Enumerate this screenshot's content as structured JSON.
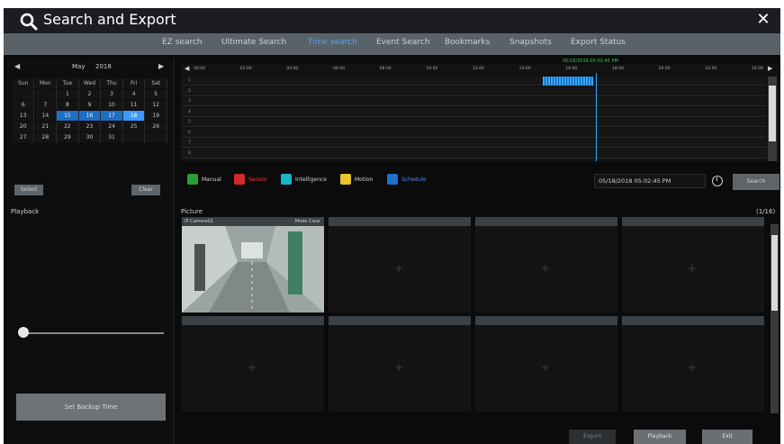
{
  "window": {
    "title": "Search and Export"
  },
  "tabs": [
    {
      "label": "EZ search",
      "active": false
    },
    {
      "label": "Ultimate Search",
      "active": false
    },
    {
      "label": "Time search",
      "active": true
    },
    {
      "label": "Event Search",
      "active": false
    },
    {
      "label": "Bookmarks",
      "active": false
    },
    {
      "label": "Snapshots",
      "active": false
    },
    {
      "label": "Export Status",
      "active": false
    }
  ],
  "calendar": {
    "month": "May",
    "year": "2018",
    "weekdays": [
      "Sun",
      "Mon",
      "Tue",
      "Wed",
      "Thu",
      "Fri",
      "Sat"
    ],
    "weeks": [
      [
        "",
        "",
        "1",
        "2",
        "3",
        "4",
        "5"
      ],
      [
        "6",
        "7",
        "8",
        "9",
        "10",
        "11",
        "12"
      ],
      [
        "13",
        "14",
        "15",
        "16",
        "17",
        "18",
        "19"
      ],
      [
        "20",
        "21",
        "22",
        "23",
        "24",
        "25",
        "26"
      ],
      [
        "27",
        "28",
        "29",
        "30",
        "31",
        "",
        ""
      ]
    ],
    "highlighted": [
      "15",
      "16",
      "17"
    ],
    "selected": "18",
    "select_label": "Select",
    "clear_label": "Clear"
  },
  "playback": {
    "label": "Playback",
    "progress": 0,
    "set_backup_label": "Set Backup Time"
  },
  "timeline": {
    "marker_label": "05/18/2018 05:02:45 PM",
    "ticks": [
      "00:00",
      "02:00",
      "04:00",
      "06:00",
      "08:00",
      "10:00",
      "12:00",
      "14:00",
      "16:00",
      "18:00",
      "20:00",
      "22:00",
      "24:00"
    ],
    "rows": [
      "1",
      "2",
      "3",
      "4",
      "5",
      "6",
      "7",
      "8"
    ]
  },
  "legend": [
    {
      "label": "Manual",
      "color": "#2e9e3a",
      "text_color": "#cfd4da"
    },
    {
      "label": "Sensor",
      "color": "#d42a2a",
      "text_color": "#ff3b3b"
    },
    {
      "label": "Intelligence",
      "color": "#19b4c8",
      "text_color": "#cfd4da"
    },
    {
      "label": "Motion",
      "color": "#e7c62b",
      "text_color": "#cfd4da"
    },
    {
      "label": "Schedule",
      "color": "#1f6fd0",
      "text_color": "#4a8cff"
    }
  ],
  "datetime_value": "05/18/2018 05:02:45 PM",
  "search_label": "Search",
  "picture": {
    "label": "Picture",
    "count": "(1/16)",
    "thumbnails": [
      {
        "title": "IP Camera01",
        "tag1": "Mode",
        "tag2": "Clear",
        "has_image": true
      },
      {
        "title": "",
        "has_image": false
      },
      {
        "title": "",
        "has_image": false
      },
      {
        "title": "",
        "has_image": false
      },
      {
        "title": "",
        "has_image": false
      },
      {
        "title": "",
        "has_image": false
      },
      {
        "title": "",
        "has_image": false
      },
      {
        "title": "",
        "has_image": false
      }
    ]
  },
  "bottom_buttons": {
    "export": "Export",
    "playback": "Playback",
    "exit": "Exit"
  },
  "colors": {
    "accent": "#3a9bff",
    "tab_bar": "#5a6269",
    "title_bar": "#1b1d21"
  },
  "icons": {
    "title": "magnifier-icon",
    "close": "close-icon",
    "clock": "clock-icon"
  }
}
